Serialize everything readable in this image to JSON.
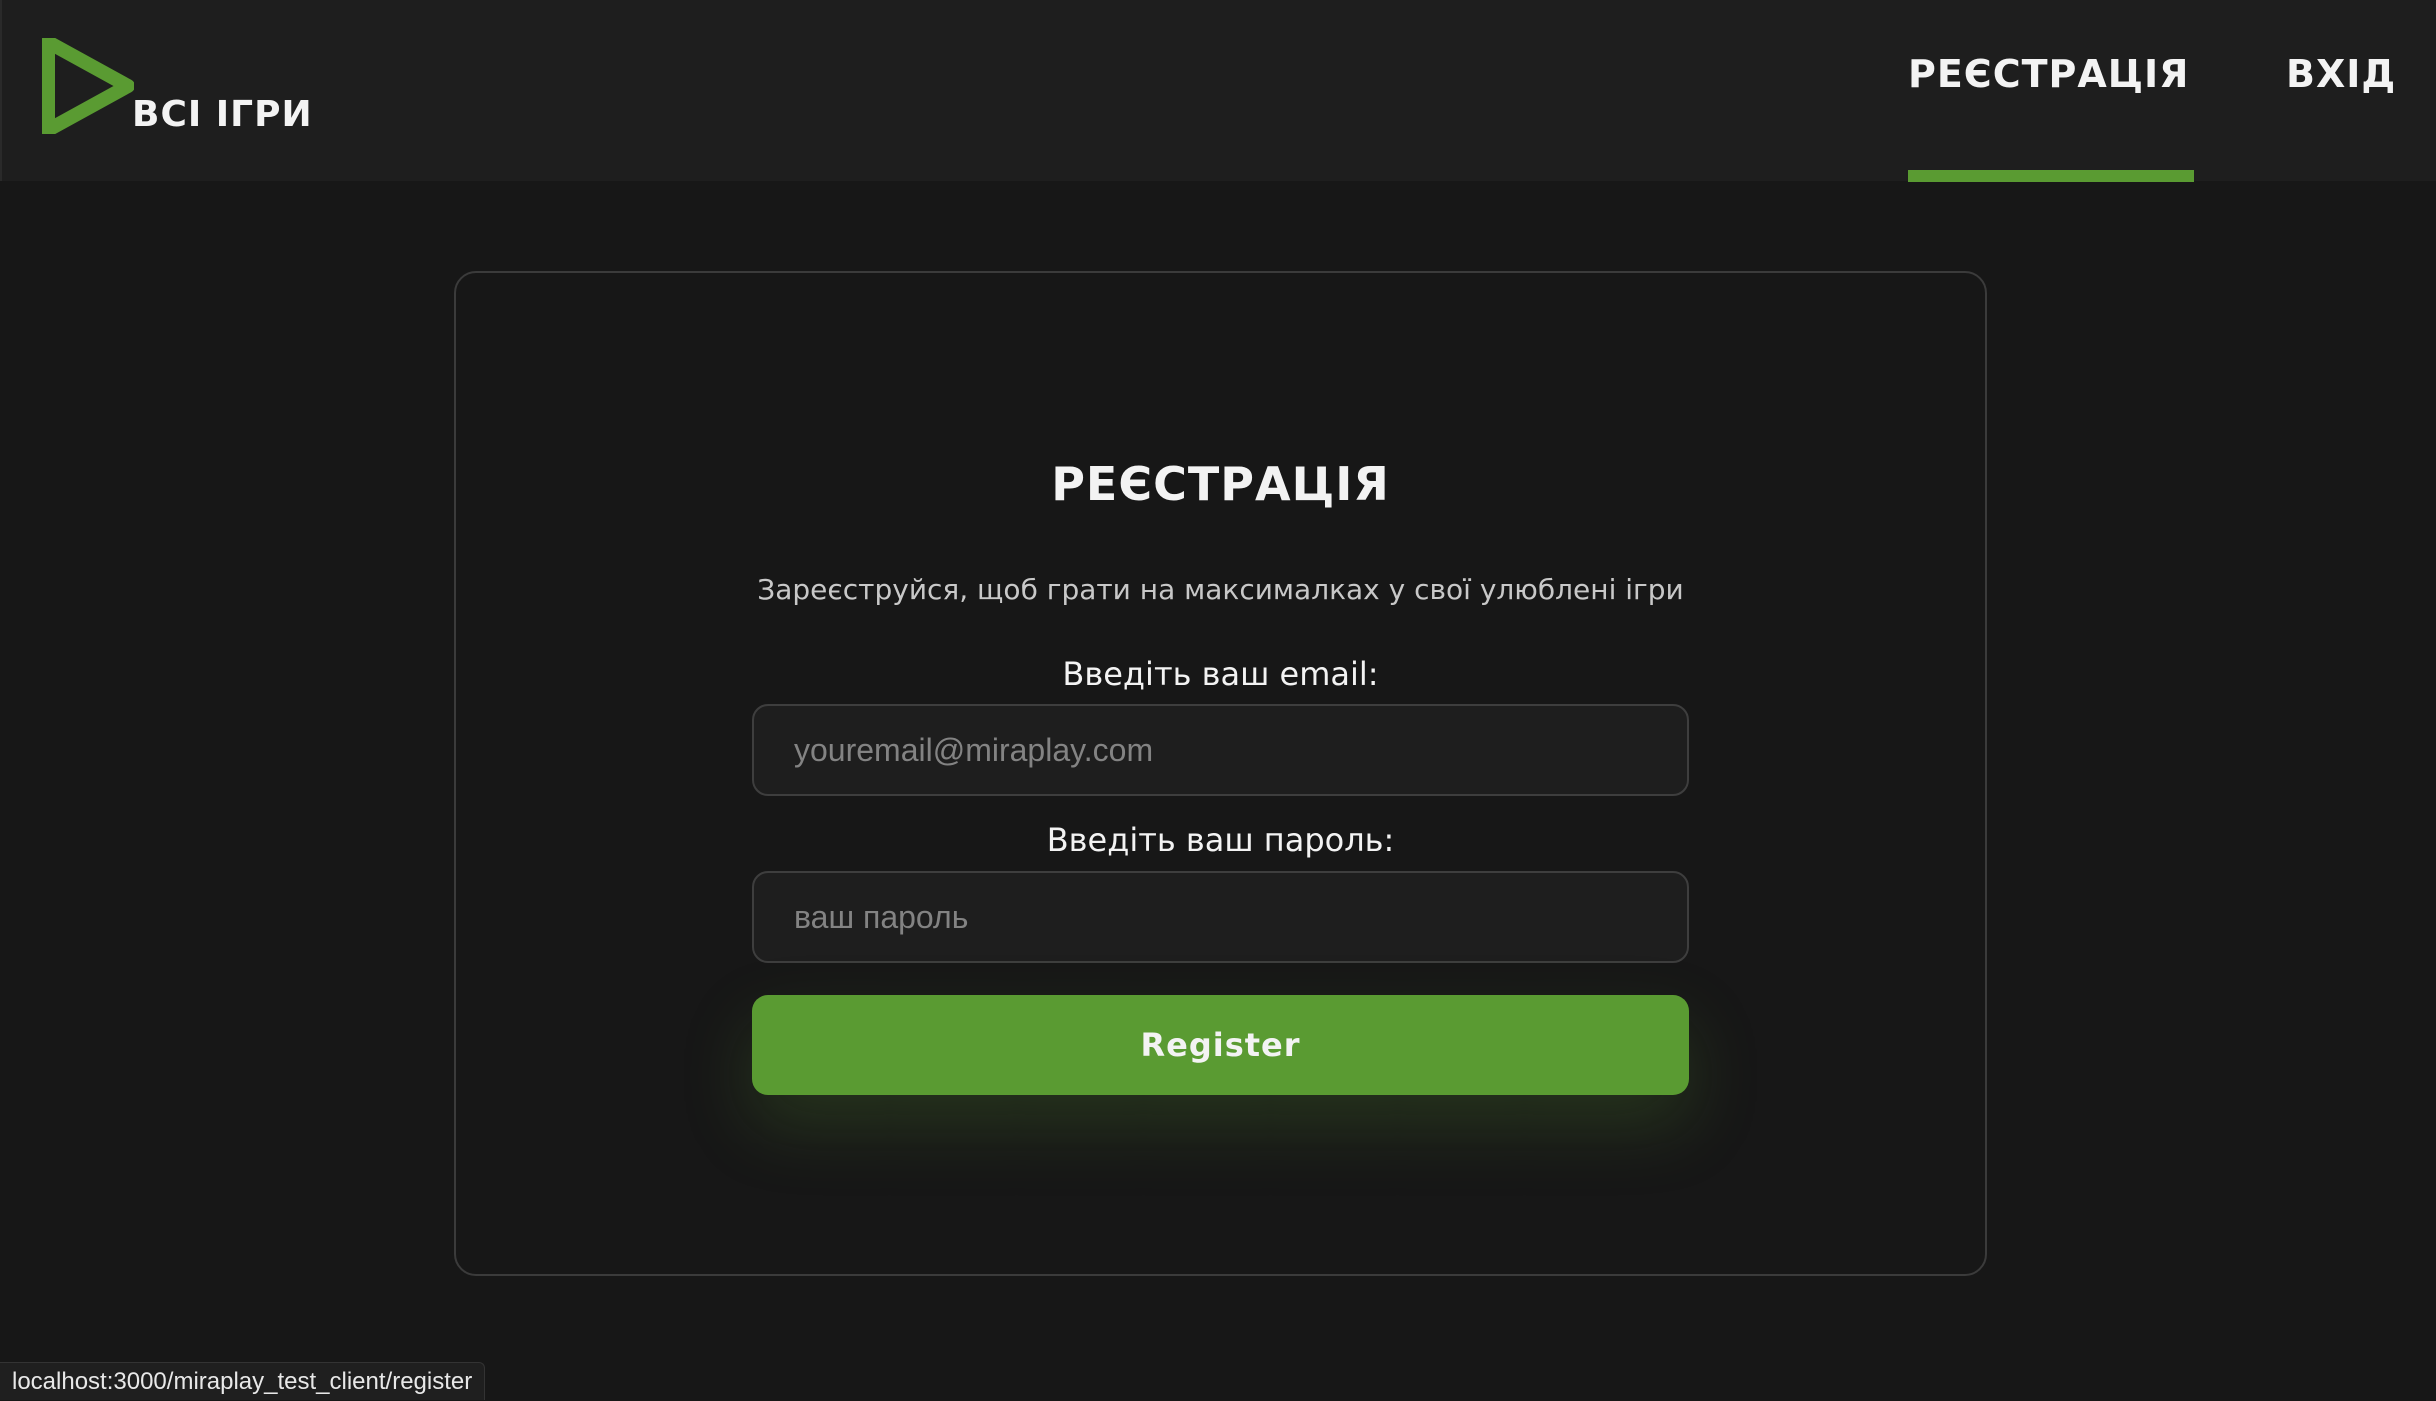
{
  "header": {
    "logo_text": "ВСІ ІГРИ",
    "nav": {
      "register": "РЕЄСТРАЦІЯ",
      "login": "ВХІД"
    },
    "active_nav": "register"
  },
  "form": {
    "title": "РЕЄСТРАЦІЯ",
    "subtitle": "Зареєструйся, щоб грати на максималках у свої улюблені ігри",
    "email_label": "Введіть ваш email:",
    "email_placeholder": "youremail@miraplay.com",
    "email_value": "",
    "password_label": "Введіть ваш пароль:",
    "password_placeholder": "ваш пароль",
    "password_value": "",
    "submit_label": "Register"
  },
  "status_bar": {
    "url": "localhost:3000/miraplay_test_client/register"
  },
  "colors": {
    "accent": "#5a9b32",
    "background": "#171717",
    "header_bg": "#1e1e1e",
    "text": "#f3f3f3"
  }
}
